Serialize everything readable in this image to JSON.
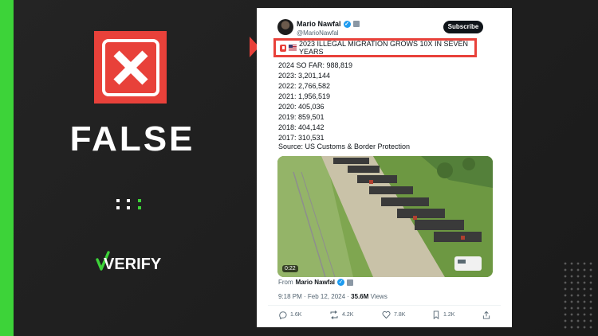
{
  "verdict": {
    "label": "FALSE",
    "x_icon": "close-icon"
  },
  "brand": {
    "logo_text": "VERIFY",
    "accent": "#3dd339"
  },
  "colors": {
    "false_red": "#e8413a",
    "green": "#3dd339",
    "background": "#1e1e1e"
  },
  "tweet": {
    "author_name": "Mario Nawfal",
    "handle": "@MarioNawfal",
    "subscribe_label": "Subscribe",
    "headline": "2023 ILLEGAL MIGRATION GROWS 10X IN SEVEN YEARS",
    "stats": [
      "2024 SO FAR: 988,819",
      "2023: 3,201,144",
      "2022: 2,766,582",
      "2021: 1,956,519",
      "2020: 405,036",
      "2019: 859,501",
      "2018: 404,142",
      "2017: 310,531"
    ],
    "source": "Source: US Customs & Border Protection",
    "video_duration": "0:22",
    "from_prefix": "From",
    "from_name": "Mario Nawfal",
    "timestamp": "9:18 PM · Feb 12, 2024 · ",
    "views_count": "35.6M",
    "views_label": " Views",
    "actions": {
      "replies": "1.6K",
      "reposts": "4.2K",
      "likes": "7.8K",
      "bookmarks": "1.2K"
    }
  }
}
